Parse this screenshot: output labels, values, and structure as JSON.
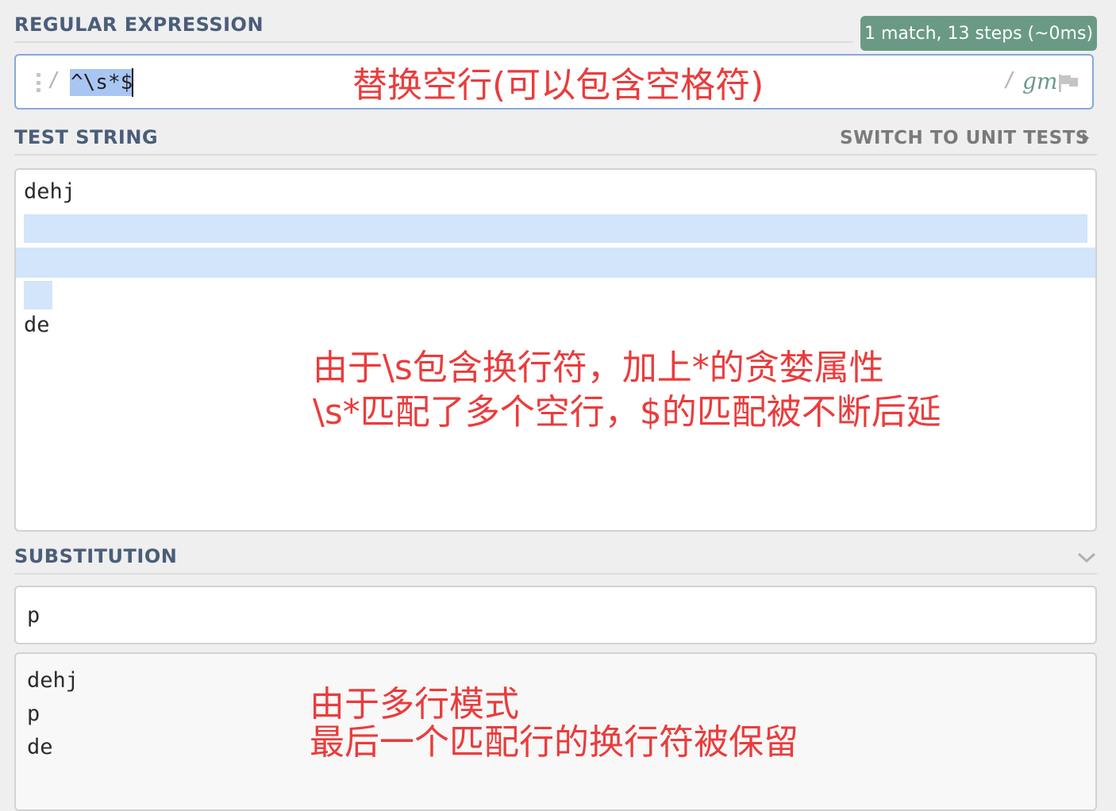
{
  "regex": {
    "header": "REGULAR EXPRESSION",
    "match_info": "1 match, 13 steps (~0ms)",
    "open_delimiter": "/",
    "pattern": "^\\s*$",
    "close_delimiter": "/",
    "flags": "gm",
    "annotation": "替换空行(可以包含空格符)"
  },
  "test": {
    "header": "TEST STRING",
    "switch_label": "SWITCH TO UNIT TESTS",
    "lines": [
      "dehj",
      "",
      "",
      "",
      "de"
    ],
    "annotation_line1": "由于\\s包含换行符，加上*的贪婪属性",
    "annotation_line2": "\\s*匹配了多个空行，$的匹配被不断后延"
  },
  "substitution": {
    "header": "SUBSTITUTION",
    "value": "p",
    "result_lines": [
      "dehj",
      "p",
      "de"
    ],
    "annotation_line1": "由于多行模式",
    "annotation_line2": "最后一个匹配行的换行符被保留"
  },
  "colors": {
    "accent": "#6a9a86",
    "header_text": "#4a5e7a",
    "annotation": "#ea3c3c",
    "match_highlight": "#d2e5fb"
  }
}
